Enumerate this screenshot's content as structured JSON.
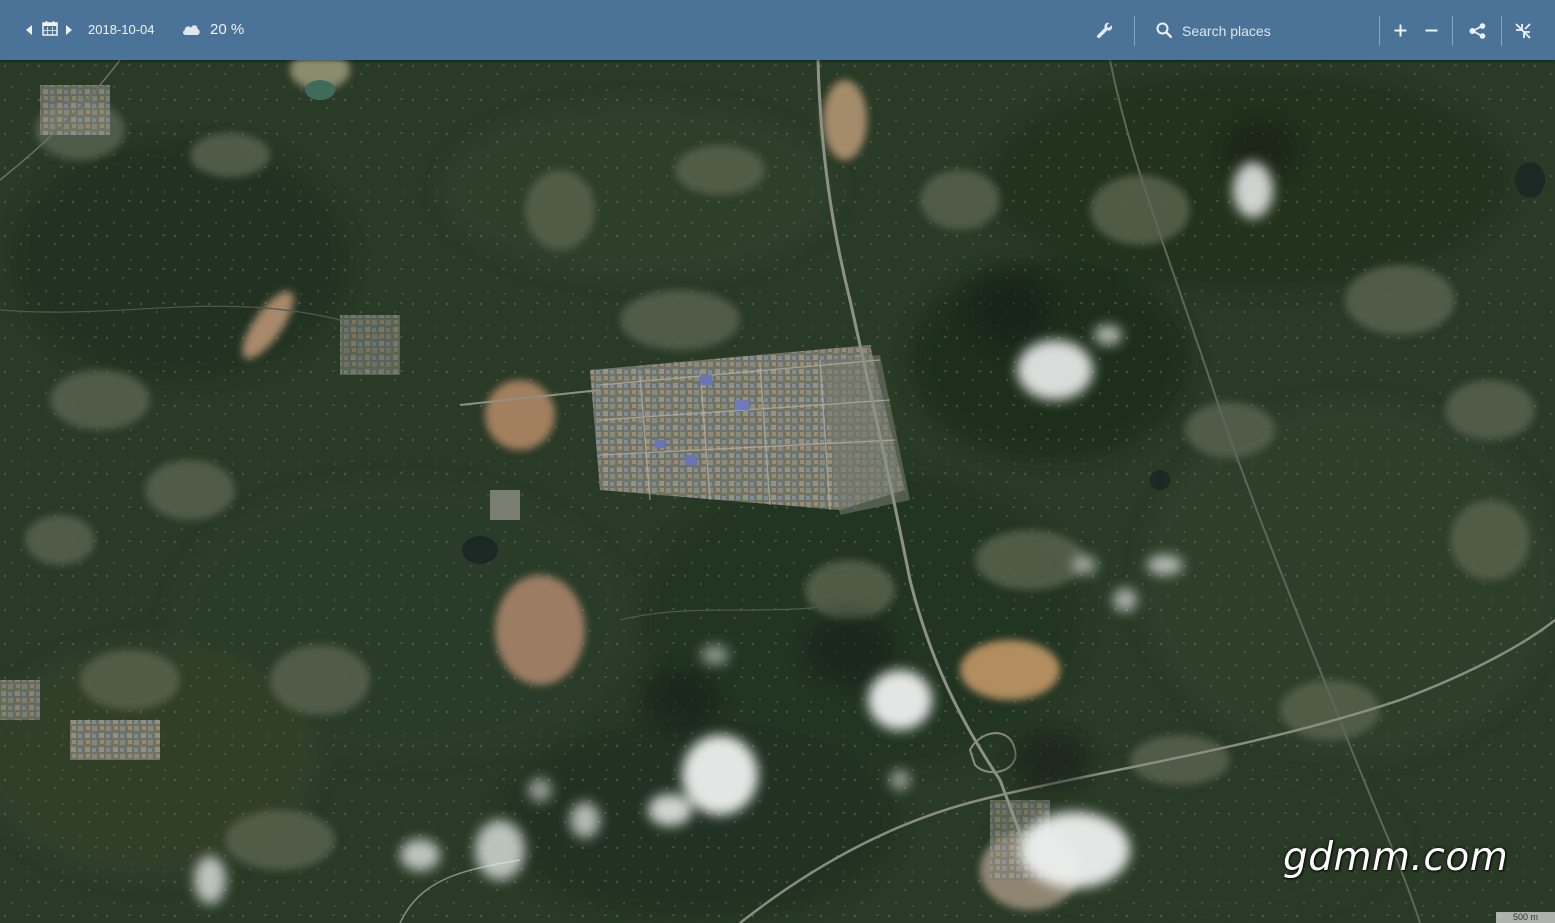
{
  "toolbar": {
    "date": "2018-10-04",
    "cloud_coverage": "20 %",
    "search_placeholder": "Search places",
    "icons": {
      "prev": "triangle-left-icon",
      "calendar": "calendar-icon",
      "next": "triangle-right-icon",
      "cloud": "cloud-icon",
      "tools": "wrench-icon",
      "search": "search-icon",
      "zoom_in": "plus-icon",
      "zoom_out": "minus-icon",
      "share": "share-icon",
      "close": "collapse-icon"
    },
    "colors": {
      "bar": "#4b7398",
      "text": "#eef3f8"
    }
  },
  "map": {
    "watermark": "gdmm.com",
    "scale_label": "500 m"
  }
}
